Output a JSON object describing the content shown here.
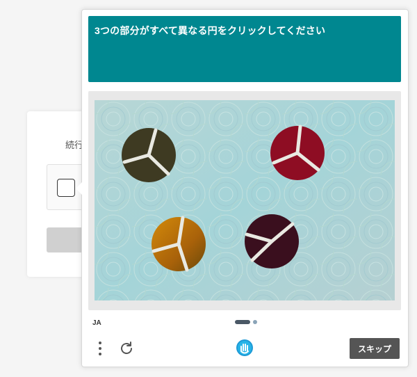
{
  "challenge": {
    "prompt": "3つの部分がすべて異なる円をクリックしてください",
    "language": "JA",
    "skip_label": "スキップ",
    "pager": {
      "current_page": 1,
      "total_pages": 2
    },
    "accent_color": "#008790",
    "task_circles": [
      {
        "position": "top-left",
        "color": "#3e3a22",
        "sectors": 3
      },
      {
        "position": "top-right",
        "color": "#8e0d23",
        "sectors": 3
      },
      {
        "position": "bottom-left",
        "color": "#b06a08",
        "sectors": 3
      },
      {
        "position": "bottom-right",
        "color": "#3a0f1e",
        "sectors": 3
      }
    ]
  },
  "background_card": {
    "label": "続行"
  },
  "icons": {
    "menu": "vertical-ellipsis-icon",
    "refresh": "refresh-icon",
    "logo": "hand-logo-icon"
  }
}
